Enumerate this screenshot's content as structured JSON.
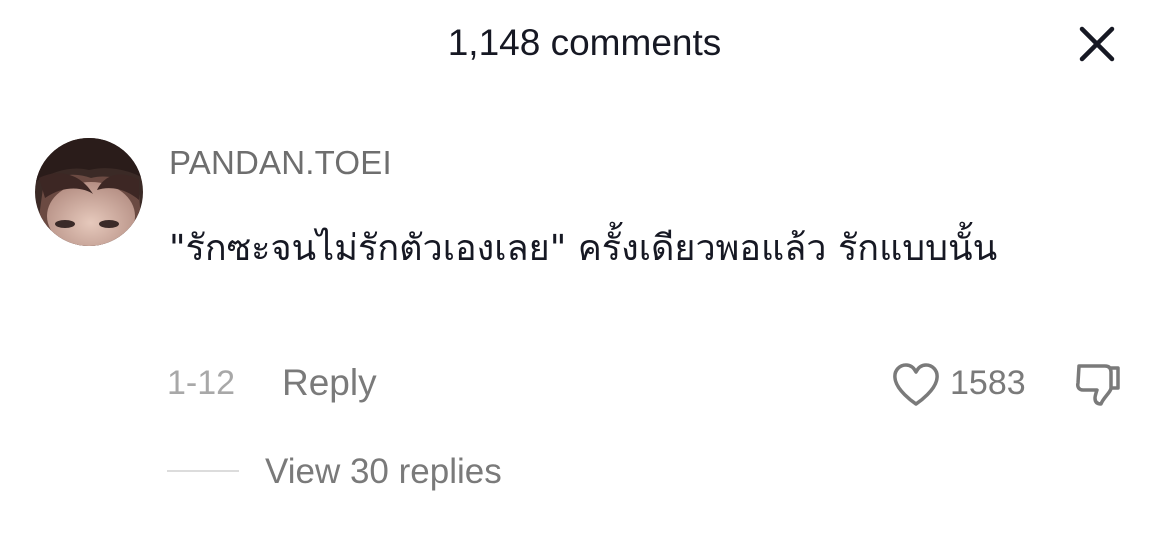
{
  "header": {
    "title": "1,148 comments",
    "close_icon": "close-icon"
  },
  "comment": {
    "username": "PANDAN.TOEI",
    "text": "\"รักซะจนไม่รักตัวเองเลย\" ครั้งเดียวพอแล้ว รักแบบนั้น",
    "date": "1-12",
    "reply_label": "Reply",
    "like_count": "1583",
    "like_icon": "heart-outline-icon",
    "dislike_icon": "thumbs-down-icon",
    "view_replies_label": "View 30 replies"
  },
  "colors": {
    "primary_text": "#161823",
    "secondary_text": "#7a7a7a",
    "muted_text": "#a8a8a8",
    "background": "#ffffff"
  }
}
